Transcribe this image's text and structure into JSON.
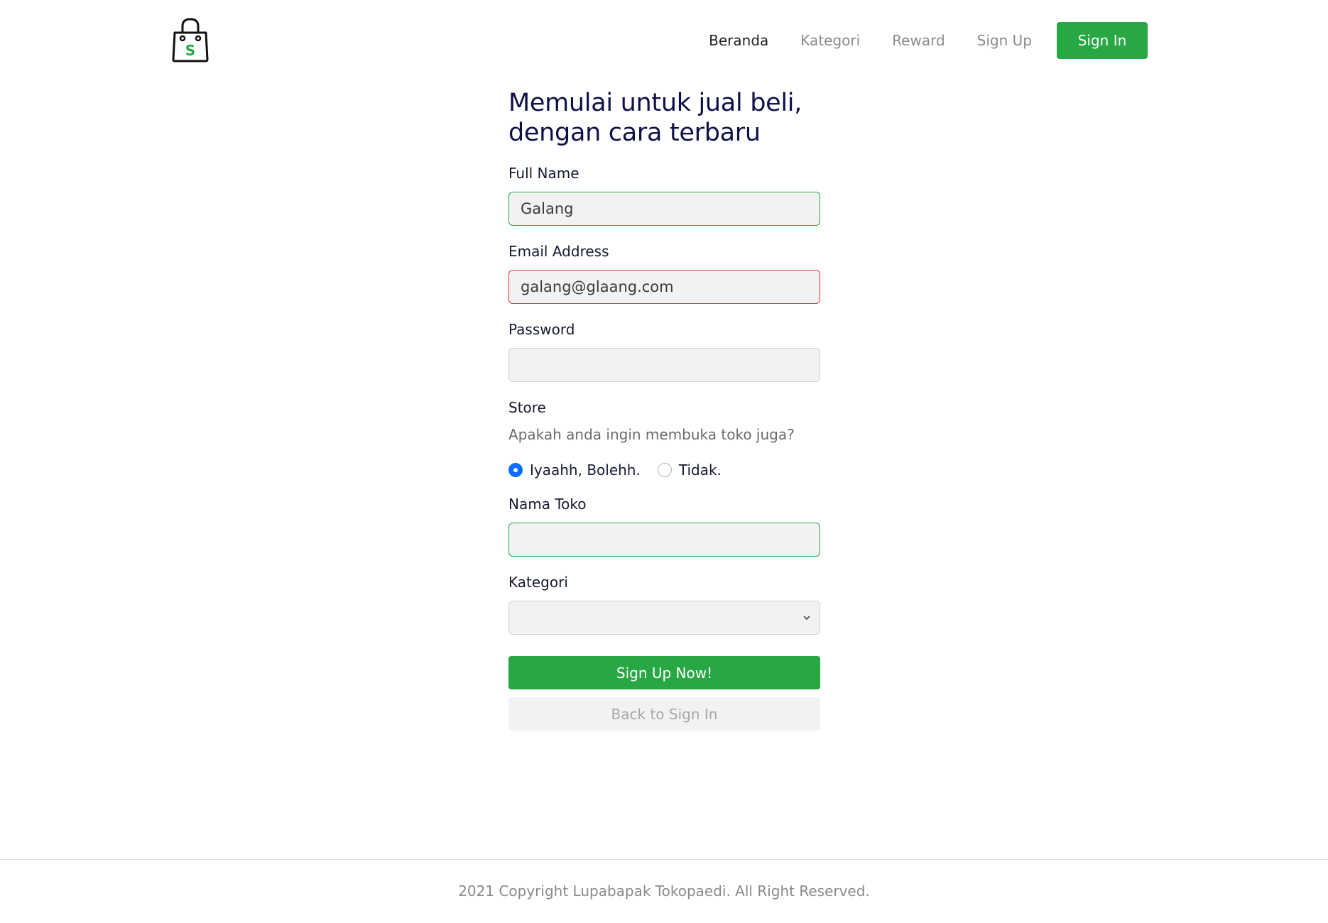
{
  "nav": {
    "links": [
      "Beranda",
      "Kategori",
      "Reward",
      "Sign Up"
    ],
    "signin_label": "Sign In",
    "brand_letter": "S"
  },
  "form": {
    "headline_line1": "Memulai untuk jual beli,",
    "headline_line2": "dengan cara terbaru",
    "full_name_label": "Full Name",
    "full_name_value": "Galang",
    "email_label": "Email Address",
    "email_value": "galang@glaang.com",
    "password_label": "Password",
    "password_value": "",
    "store_label": "Store",
    "store_question": "Apakah anda ingin membuka toko juga?",
    "radio_yes": "Iyaahh, Bolehh.",
    "radio_no": "Tidak.",
    "store_name_label": "Nama Toko",
    "store_name_value": "",
    "category_label": "Kategori",
    "category_value": "",
    "submit_label": "Sign Up Now!",
    "back_label": "Back to Sign In"
  },
  "footer": {
    "copyright": "2021 Copyright Lupabapak Tokopaedi. All Right Reserved."
  },
  "colors": {
    "primary": "#28a745",
    "invalid": "#dc3545",
    "radio_checked": "#0d6efd"
  }
}
